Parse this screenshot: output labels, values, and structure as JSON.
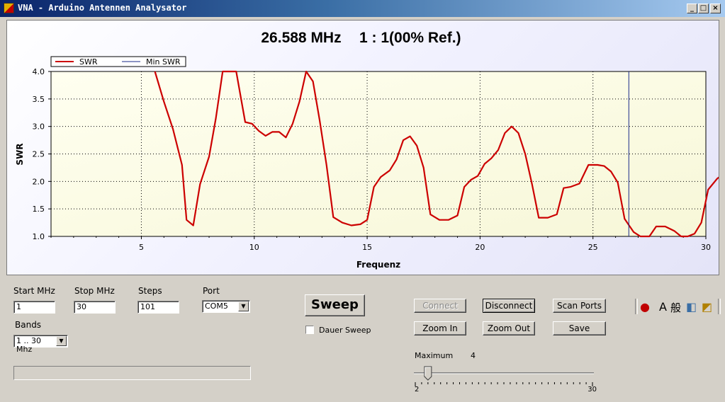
{
  "window": {
    "title": "VNA - Arduino Antennen Analysator"
  },
  "chart_header": {
    "frequency": "26.588 MHz",
    "ratio": "1 : 1(00% Ref.)"
  },
  "chart_data": {
    "type": "line",
    "xlabel": "Frequenz",
    "ylabel": "SWR",
    "xlim": [
      1,
      30
    ],
    "ylim": [
      1.0,
      4.0
    ],
    "x_ticks": [
      5,
      10,
      15,
      20,
      25,
      30
    ],
    "y_ticks": [
      "1.0",
      "1.5",
      "2.0",
      "2.5",
      "3.0",
      "3.5",
      "4.0"
    ],
    "grid": true,
    "legend_placement": "top-left",
    "series": [
      {
        "name": "SWR",
        "color": "#cc0000",
        "points": [
          [
            5.6,
            4.0
          ],
          [
            6.0,
            3.45
          ],
          [
            6.4,
            2.95
          ],
          [
            6.8,
            2.3
          ],
          [
            7.0,
            1.3
          ],
          [
            7.3,
            1.2
          ],
          [
            7.6,
            1.95
          ],
          [
            8.0,
            2.45
          ],
          [
            8.3,
            3.15
          ],
          [
            8.6,
            4.0
          ],
          [
            9.2,
            4.0
          ],
          [
            9.6,
            3.08
          ],
          [
            9.9,
            3.05
          ],
          [
            10.2,
            2.92
          ],
          [
            10.5,
            2.83
          ],
          [
            10.8,
            2.9
          ],
          [
            11.1,
            2.9
          ],
          [
            11.4,
            2.8
          ],
          [
            11.7,
            3.05
          ],
          [
            12.0,
            3.45
          ],
          [
            12.3,
            4.0
          ],
          [
            12.6,
            3.82
          ],
          [
            12.9,
            3.1
          ],
          [
            13.2,
            2.3
          ],
          [
            13.5,
            1.35
          ],
          [
            13.9,
            1.25
          ],
          [
            14.3,
            1.2
          ],
          [
            14.7,
            1.22
          ],
          [
            15.0,
            1.3
          ],
          [
            15.3,
            1.9
          ],
          [
            15.6,
            2.08
          ],
          [
            16.0,
            2.2
          ],
          [
            16.3,
            2.4
          ],
          [
            16.6,
            2.75
          ],
          [
            16.9,
            2.82
          ],
          [
            17.2,
            2.65
          ],
          [
            17.5,
            2.25
          ],
          [
            17.8,
            1.4
          ],
          [
            18.2,
            1.3
          ],
          [
            18.6,
            1.3
          ],
          [
            19.0,
            1.38
          ],
          [
            19.3,
            1.9
          ],
          [
            19.6,
            2.03
          ],
          [
            19.9,
            2.1
          ],
          [
            20.2,
            2.32
          ],
          [
            20.5,
            2.42
          ],
          [
            20.8,
            2.57
          ],
          [
            21.1,
            2.88
          ],
          [
            21.4,
            3.0
          ],
          [
            21.7,
            2.88
          ],
          [
            22.0,
            2.5
          ],
          [
            22.3,
            1.95
          ],
          [
            22.6,
            1.34
          ],
          [
            23.0,
            1.34
          ],
          [
            23.4,
            1.4
          ],
          [
            23.7,
            1.88
          ],
          [
            24.0,
            1.9
          ],
          [
            24.4,
            1.96
          ],
          [
            24.8,
            2.3
          ],
          [
            25.2,
            2.3
          ],
          [
            25.5,
            2.28
          ],
          [
            25.8,
            2.18
          ],
          [
            26.1,
            1.98
          ],
          [
            26.4,
            1.32
          ],
          [
            26.8,
            1.08
          ],
          [
            27.1,
            1.0
          ],
          [
            27.5,
            1.0
          ],
          [
            27.8,
            1.18
          ],
          [
            28.2,
            1.18
          ],
          [
            28.6,
            1.1
          ],
          [
            28.9,
            1.0
          ],
          [
            29.2,
            1.0
          ],
          [
            29.5,
            1.05
          ],
          [
            29.8,
            1.25
          ],
          [
            30.1,
            1.85
          ],
          [
            30.5,
            2.05
          ],
          [
            30.9,
            2.18
          ]
        ]
      },
      {
        "name": "Min SWR",
        "color": "#1a2a8a",
        "marker_x": 26.588
      }
    ]
  },
  "controls": {
    "start_label": "Start MHz",
    "start_value": "1",
    "stop_label": "Stop MHz",
    "stop_value": "30",
    "steps_label": "Steps",
    "steps_value": "101",
    "port_label": "Port",
    "port_value": "COM5",
    "bands_label": "Bands",
    "bands_value": "1 .. 30 Mhz",
    "sweep_button": "Sweep",
    "dauer_sweep_label": "Dauer Sweep",
    "connect_button": "Connect",
    "disconnect_button": "Disconnect",
    "scan_ports_button": "Scan Ports",
    "zoom_in_button": "Zoom In",
    "zoom_out_button": "Zoom Out",
    "save_button": "Save",
    "maximum_label": "Maximum",
    "maximum_value": 4,
    "slider_min": 2,
    "slider_max": 30,
    "slider_min_label": "2",
    "slider_max_label": "30"
  }
}
